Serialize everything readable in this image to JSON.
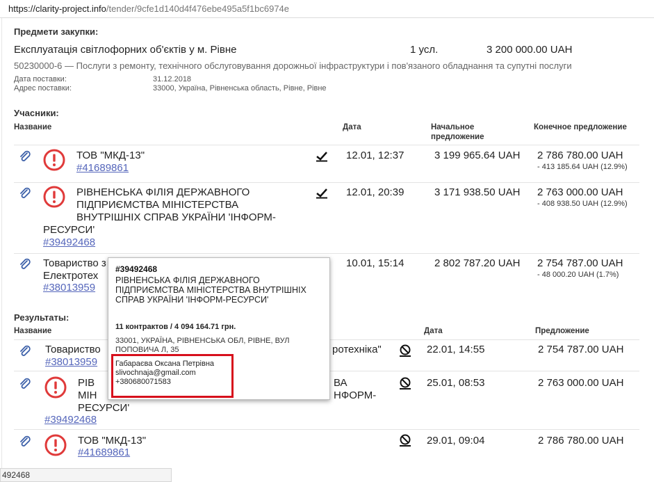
{
  "browser": {
    "url_host": "https://clarity-project.info",
    "url_path": "/tender/9cfe1d140d4f476ebe495a5f1bc6974e"
  },
  "procurement": {
    "section_title": "Предмети закупки:",
    "item_name": "Експлуатація світлофорних об'єктів у м. Рівне",
    "quantity": "1 усл.",
    "amount": "3 200 000.00 UAH",
    "cpv": "50230000-6 — Послуги з ремонту, технічного обслуговування дорожньої інфраструктури і пов'язаного обладнання та супутні послуги",
    "delivery_date_label": "Дата поставки:",
    "delivery_date": "31.12.2018",
    "delivery_address_label": "Адрес поставки:",
    "delivery_address": "33000, Україна, Рівненська область, Рівне, Рівне"
  },
  "participants": {
    "title": "Учасники:",
    "col_name": "Название",
    "col_date": "Дата",
    "col_initial_1": "Начальное",
    "col_initial_2": "предложение",
    "col_final": "Конечное предложение",
    "rows": [
      {
        "name_lines": [
          "ТОВ \"МКД-13\""
        ],
        "id": "#41689861",
        "date": "12.01, 12:37",
        "initial": "3 199 965.64 UAH",
        "final": "2 786 780.00 UAH",
        "diff": "- 413 185.64 UAH (12.9%)"
      },
      {
        "name_lines": [
          "РІВНЕНСЬКА ФІЛІЯ ДЕРЖАВНОГО",
          "ПІДПРИЄМСТВА МІНІСТЕРСТВА",
          "ВНУТРІШНІХ СПРАВ УКРАЇНИ 'ІНФОРМ-",
          "РЕСУРСИ'"
        ],
        "id": "#39492468",
        "date": "12.01, 20:39",
        "initial": "3 171 938.50 UAH",
        "final": "2 763 000.00 UAH",
        "diff": "- 408 938.50 UAH (12.9%)"
      },
      {
        "name_lines": [
          "Товариство з",
          "Електротех"
        ],
        "id": "#38013959",
        "date": "10.01, 15:14",
        "initial": "2 802 787.20 UAH",
        "final": "2 754 787.00 UAH",
        "diff": "- 48 000.20 UAH (1.7%)"
      }
    ]
  },
  "results": {
    "title": "Результаты:",
    "col_name": "Название",
    "col_date": "Дата",
    "col_offer": "Предложение",
    "rows": [
      {
        "name_lines": [
          "Товариство",
          "ротехніка\""
        ],
        "id": "#38013959",
        "date": "22.01, 14:55",
        "offer": "2 754 787.00 UAH"
      },
      {
        "name_lines": [
          "РІВ",
          "МІН",
          "РЕСУРСИ'",
          "ВА",
          "НФОРМ-"
        ],
        "id": "#39492468",
        "date": "25.01, 08:53",
        "offer": "2 763 000.00 UAH"
      },
      {
        "name_lines": [
          "ТОВ \"МКД-13\""
        ],
        "id": "#41689861",
        "date": "29.01, 09:04",
        "offer": "2 786 780.00 UAH"
      }
    ]
  },
  "tooltip": {
    "id": "#39492468",
    "name": "РІВНЕНСЬКА ФІЛІЯ ДЕРЖАВНОГО ПІДПРИЄМСТВА МІНІСТЕРСТВА ВНУТРІШНІХ СПРАВ УКРАЇНИ 'ІНФОРМ-РЕСУРСИ'",
    "contracts": "11 контрактов / 4 094 164.71 грн.",
    "address": "33001, УКРАЇНА, РІВНЕНСЬКА ОБЛ, РІВНЕ, ВУЛ ПОПОВИЧА Л, 35",
    "person": "Габараєва Оксана Петрівна",
    "email": "slivochnaja@gmail.com",
    "phone": "+380680071583"
  },
  "status_bar": {
    "text": "492468"
  },
  "colors": {
    "warning_red": "#e03a3a",
    "link_blue": "#5566bb",
    "highlight_red": "#d7101c"
  }
}
